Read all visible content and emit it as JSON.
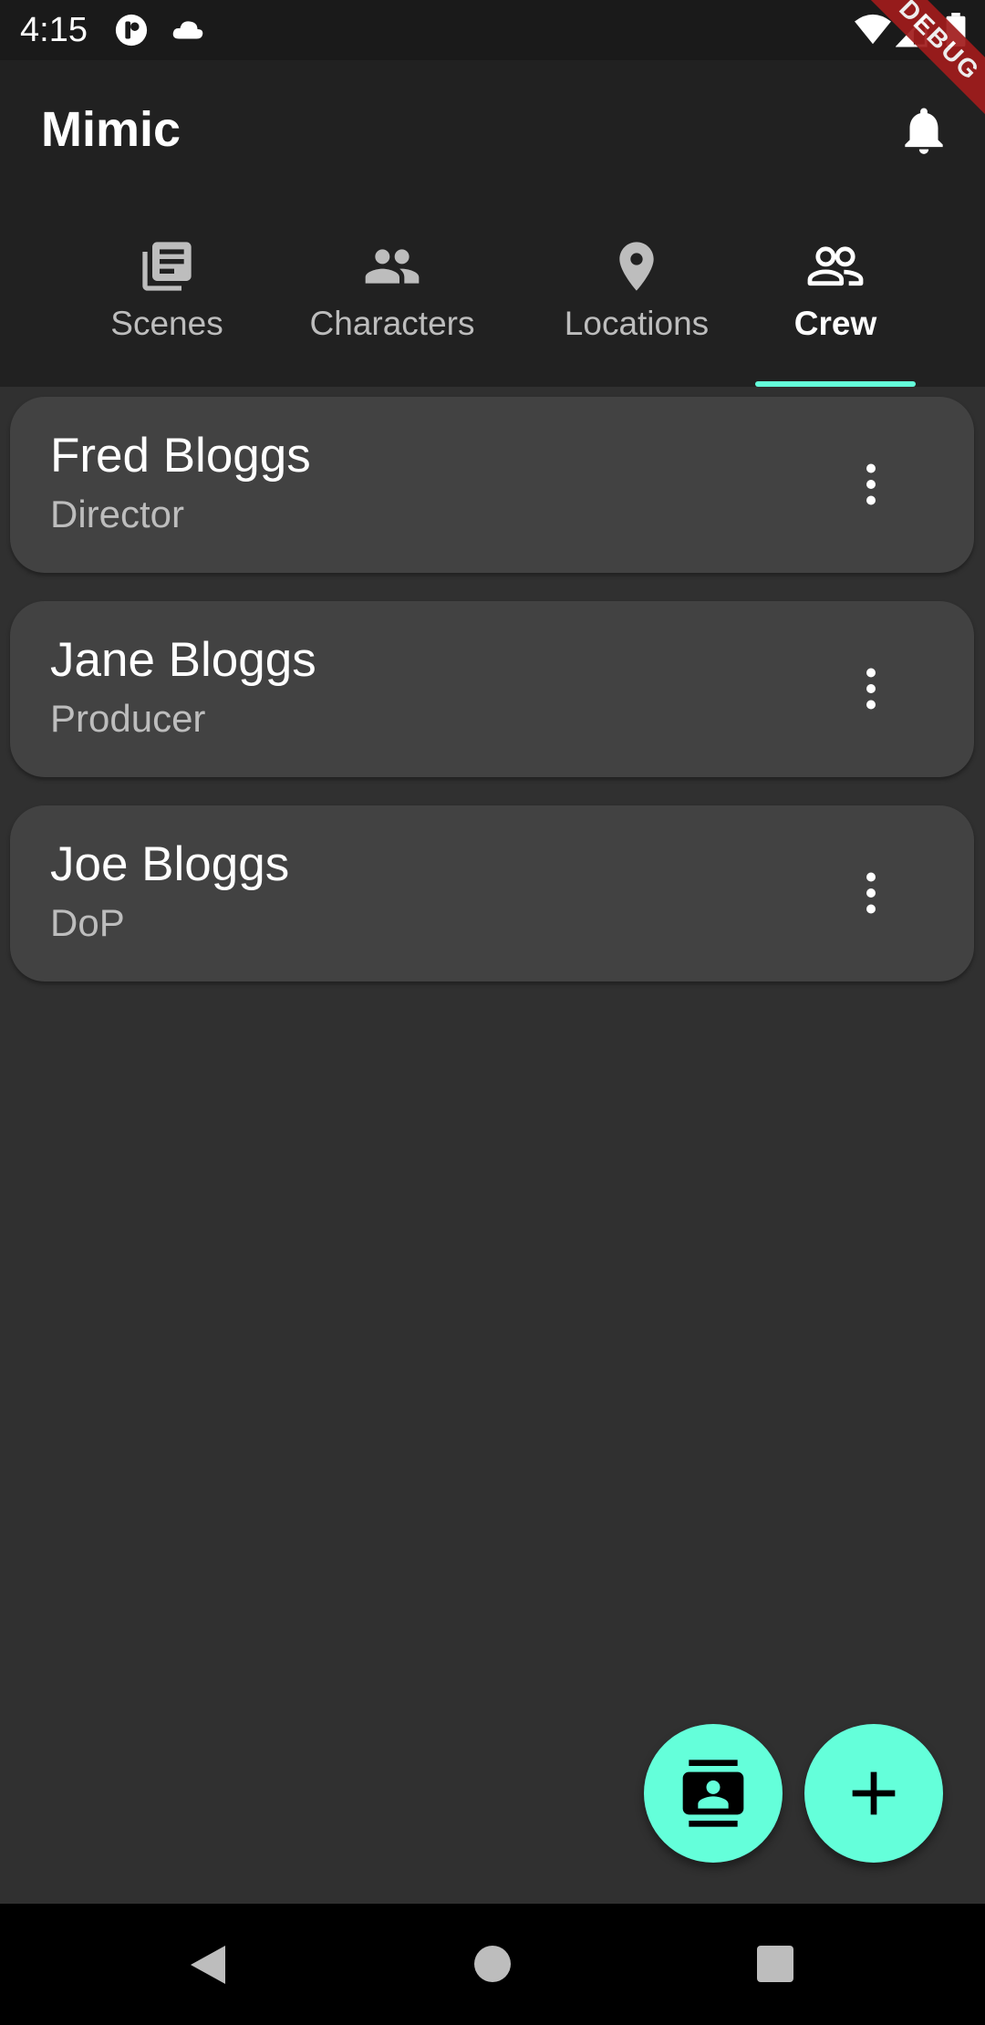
{
  "status_bar": {
    "time": "4:15",
    "icons": [
      "notification-app-icon",
      "cloud-icon",
      "wifi-icon",
      "signal-icon",
      "battery-icon"
    ]
  },
  "app_bar": {
    "title": "Mimic",
    "action_icon": "bell-icon"
  },
  "tabs": [
    {
      "label": "Scenes",
      "icon": "newspaper-icon",
      "selected": false
    },
    {
      "label": "Characters",
      "icon": "people-icon",
      "selected": false
    },
    {
      "label": "Locations",
      "icon": "location-pin-icon",
      "selected": false
    },
    {
      "label": "Crew",
      "icon": "group-outline-icon",
      "selected": true
    }
  ],
  "crew": [
    {
      "name": "Fred Bloggs",
      "role": "Director"
    },
    {
      "name": "Jane Bloggs",
      "role": "Producer"
    },
    {
      "name": "Joe Bloggs",
      "role": "DoP"
    }
  ],
  "fabs": {
    "contacts_icon": "contact-book-icon",
    "add_icon": "plus-icon"
  },
  "debug_banner": "DEBUG",
  "colors": {
    "accent": "#64ffda",
    "app_bar": "#212121",
    "background": "#303030",
    "card": "#424242",
    "tab_inactive": "#bdbdbd"
  },
  "nav_bar": {
    "buttons": [
      "back-triangle-icon",
      "home-circle-icon",
      "recents-square-icon"
    ]
  }
}
